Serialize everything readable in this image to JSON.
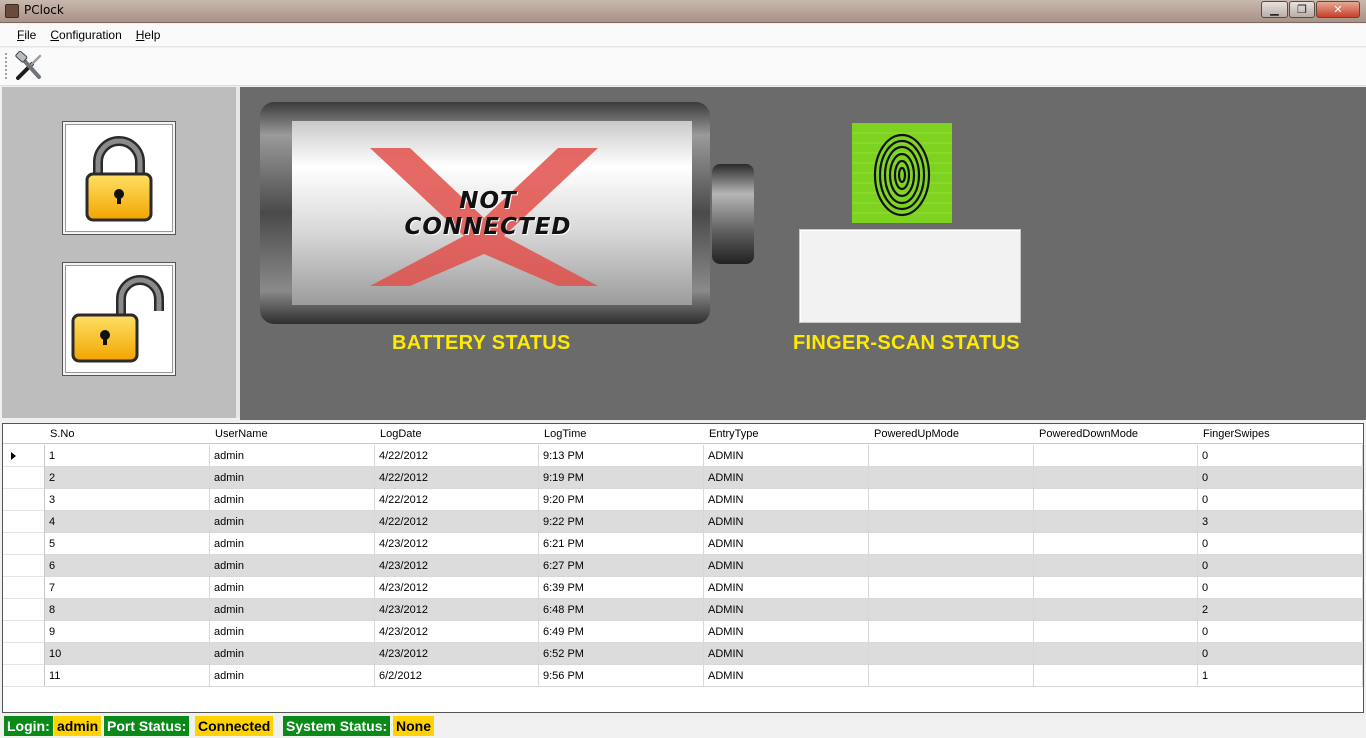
{
  "window": {
    "title": "PClock",
    "buttons": {
      "minimize": "▁",
      "maximize": "❐",
      "close": "✕"
    }
  },
  "menu": [
    {
      "accel": "F",
      "rest": "ile"
    },
    {
      "accel": "C",
      "rest": "onfiguration"
    },
    {
      "accel": "H",
      "rest": "elp"
    }
  ],
  "toolbar": {
    "tool_icon": "tools-icon"
  },
  "lock_panel": {
    "lock_icon": "padlock-closed-icon",
    "unlock_icon": "padlock-open-icon"
  },
  "battery": {
    "label": "BATTERY STATUS",
    "overlay_line1": "NOT",
    "overlay_line2": "CONNECTED"
  },
  "finger_scan": {
    "label": "FINGER-SCAN STATUS",
    "value": ""
  },
  "colors": {
    "status_label": "#ffeb00",
    "panel_bg": "#6b6b6b",
    "status_green": "#0b8a1a",
    "status_yellow": "#ffd200"
  },
  "table": {
    "columns": [
      "S.No",
      "UserName",
      "LogDate",
      "LogTime",
      "EntryType",
      "PoweredUpMode",
      "PoweredDownMode",
      "FingerSwipes"
    ],
    "rows": [
      [
        "1",
        "admin",
        "4/22/2012",
        "9:13 PM",
        "ADMIN",
        "",
        "",
        "0"
      ],
      [
        "2",
        "admin",
        "4/22/2012",
        "9:19 PM",
        "ADMIN",
        "",
        "",
        "0"
      ],
      [
        "3",
        "admin",
        "4/22/2012",
        "9:20 PM",
        "ADMIN",
        "",
        "",
        "0"
      ],
      [
        "4",
        "admin",
        "4/22/2012",
        "9:22 PM",
        "ADMIN",
        "",
        "",
        "3"
      ],
      [
        "5",
        "admin",
        "4/23/2012",
        "6:21 PM",
        "ADMIN",
        "",
        "",
        "0"
      ],
      [
        "6",
        "admin",
        "4/23/2012",
        "6:27 PM",
        "ADMIN",
        "",
        "",
        "0"
      ],
      [
        "7",
        "admin",
        "4/23/2012",
        "6:39 PM",
        "ADMIN",
        "",
        "",
        "0"
      ],
      [
        "8",
        "admin",
        "4/23/2012",
        "6:48 PM",
        "ADMIN",
        "",
        "",
        "2"
      ],
      [
        "9",
        "admin",
        "4/23/2012",
        "6:49 PM",
        "ADMIN",
        "",
        "",
        "0"
      ],
      [
        "10",
        "admin",
        "4/23/2012",
        "6:52 PM",
        "ADMIN",
        "",
        "",
        "0"
      ],
      [
        "11",
        "admin",
        "6/2/2012",
        "9:56 PM",
        "ADMIN",
        "",
        "",
        "1"
      ]
    ]
  },
  "statusbar": {
    "login_label": "Login:",
    "login_value": "admin",
    "port_label": "Port Status:",
    "port_value": "Connected",
    "system_label": "System Status:",
    "system_value": "None"
  }
}
